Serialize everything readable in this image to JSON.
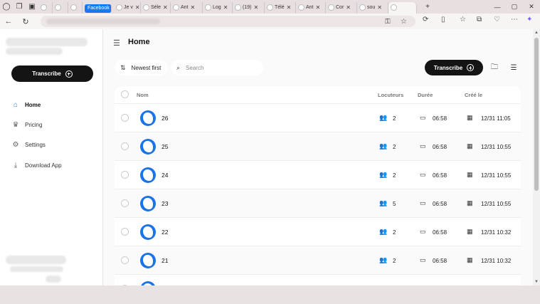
{
  "browser": {
    "tabs": [
      {
        "label": "",
        "icon": "globe-icon"
      },
      {
        "label": "",
        "icon": "globe-icon"
      },
      {
        "label": "",
        "icon": "globe-icon"
      },
      {
        "label": "Facebook",
        "icon": "facebook-icon"
      },
      {
        "label": "Je v",
        "icon": "globe-icon"
      },
      {
        "label": "Séle",
        "icon": "globe-icon"
      },
      {
        "label": "Ant",
        "icon": "globe-icon"
      },
      {
        "label": "Log",
        "icon": "globe-icon"
      },
      {
        "label": "(19)",
        "icon": "globe-icon"
      },
      {
        "label": "Télé",
        "icon": "globe-icon"
      },
      {
        "label": "Ant",
        "icon": "globe-icon"
      },
      {
        "label": "Cor",
        "icon": "globe-icon"
      },
      {
        "label": "sou",
        "icon": "globe-icon"
      },
      {
        "label": "",
        "icon": "globe-icon"
      }
    ],
    "new_tab": "+"
  },
  "sidebar": {
    "transcribe_label": "Transcribe",
    "items": [
      {
        "label": "Home",
        "icon": "home-icon",
        "active": true
      },
      {
        "label": "Pricing",
        "icon": "crown-icon",
        "active": false
      },
      {
        "label": "Settings",
        "icon": "gear-icon",
        "active": false
      },
      {
        "label": "Download App",
        "icon": "download-icon",
        "active": false
      }
    ]
  },
  "main": {
    "title": "Home",
    "sort_label": "Newest first",
    "search_placeholder": "Search",
    "transcribe_label": "Transcribe",
    "columns": {
      "name": "Nom",
      "speakers": "Locuteurs",
      "duration": "Durée",
      "created": "Créé le"
    },
    "rows": [
      {
        "name": "26",
        "speakers": "2",
        "duration": "06:58",
        "created": "12/31 11:05"
      },
      {
        "name": "25",
        "speakers": "2",
        "duration": "06:58",
        "created": "12/31 10:55"
      },
      {
        "name": "24",
        "speakers": "2",
        "duration": "06:58",
        "created": "12/31 10:55"
      },
      {
        "name": "23",
        "speakers": "5",
        "duration": "06:58",
        "created": "12/31 10:55"
      },
      {
        "name": "22",
        "speakers": "2",
        "duration": "06:58",
        "created": "12/31 10:32"
      },
      {
        "name": "21",
        "speakers": "2",
        "duration": "06:58",
        "created": "12/31 10:32"
      },
      {
        "name": "",
        "speakers": "",
        "duration": "",
        "created": ""
      }
    ]
  },
  "colors": {
    "accent": "#1a73e8",
    "button_dark": "#141414"
  }
}
